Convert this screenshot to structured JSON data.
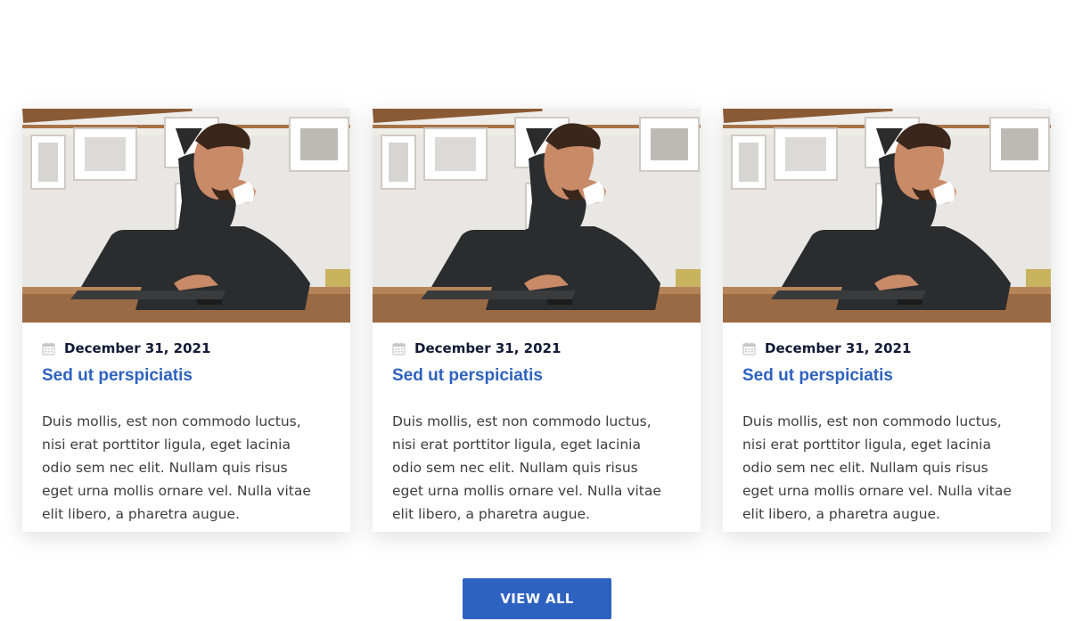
{
  "posts": [
    {
      "image_icon": "man-drinking-coffee-at-laptop-photo",
      "date_icon": "calendar-icon",
      "date": "December 31, 2021",
      "title": "Sed ut perspiciatis",
      "excerpt": "Duis mollis, est non commodo luctus, nisi erat porttitor ligula, eget lacinia odio sem nec elit. Nullam quis risus eget urna mollis ornare vel. Nulla vitae elit libero, a pharetra augue."
    },
    {
      "image_icon": "man-drinking-coffee-at-laptop-photo",
      "date_icon": "calendar-icon",
      "date": "December 31, 2021",
      "title": "Sed ut perspiciatis",
      "excerpt": "Duis mollis, est non commodo luctus, nisi erat porttitor ligula, eget lacinia odio sem nec elit. Nullam quis risus eget urna mollis ornare vel. Nulla vitae elit libero, a pharetra augue."
    },
    {
      "image_icon": "man-drinking-coffee-at-laptop-photo",
      "date_icon": "calendar-icon",
      "date": "December 31, 2021",
      "title": "Sed ut perspiciatis",
      "excerpt": "Duis mollis, est non commodo luctus, nisi erat porttitor ligula, eget lacinia odio sem nec elit. Nullam quis risus eget urna mollis ornare vel. Nulla vitae elit libero, a pharetra augue."
    }
  ],
  "view_all_label": "VIEW ALL",
  "colors": {
    "accent": "#2e62c1",
    "date_text": "#131a35",
    "body_text": "#3d3d3d"
  }
}
